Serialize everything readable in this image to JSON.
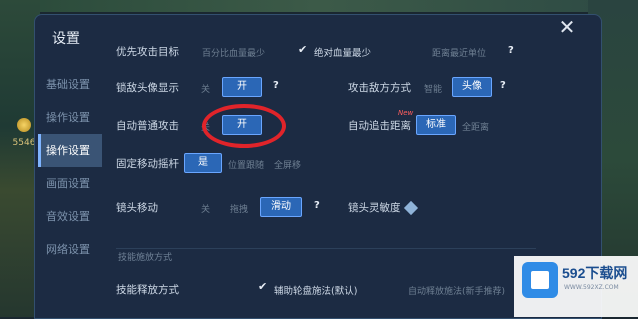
{
  "title": "设置",
  "gold": "5546",
  "sidebar": {
    "items": [
      {
        "label": "基础设置"
      },
      {
        "label": "操作设置"
      },
      {
        "label": "操作设置"
      },
      {
        "label": "画面设置"
      },
      {
        "label": "音效设置"
      },
      {
        "label": "网络设置"
      }
    ]
  },
  "rows": {
    "priority_target": {
      "label": "优先攻击目标",
      "options": [
        "百分比血量最少",
        "绝对血量最少",
        "距离最近单位"
      ]
    },
    "lock_avatar": {
      "label": "锁敌头像显示",
      "off": "关",
      "on": "开"
    },
    "attack_enemy_mode": {
      "label": "攻击敌方方式",
      "option1": "智能",
      "option2": "头像"
    },
    "auto_attack": {
      "label": "自动普通攻击",
      "off": "关",
      "on": "开"
    },
    "auto_follow": {
      "label": "自动追击距离",
      "badge": "New",
      "option1": "标准",
      "option2": "全距离"
    },
    "fixed_joystick": {
      "label": "固定移动摇杆",
      "on": "是",
      "option2": "位置跟随",
      "option3": "全屏移"
    },
    "camera_move": {
      "label": "镜头移动",
      "off": "关",
      "option1": "拖拽",
      "option2": "滑动"
    },
    "camera_sensitivity": {
      "label": "镜头灵敏度"
    },
    "section_label": "技能施放方式",
    "skill_mode": {
      "label": "技能释放方式",
      "option1": "辅助轮盘施法(默认)",
      "option2": "自动释放施法(新手推荐)"
    }
  },
  "help_mark": "?",
  "watermark": {
    "brand": "592下载网",
    "url": "WWW.592XZ.COM"
  }
}
